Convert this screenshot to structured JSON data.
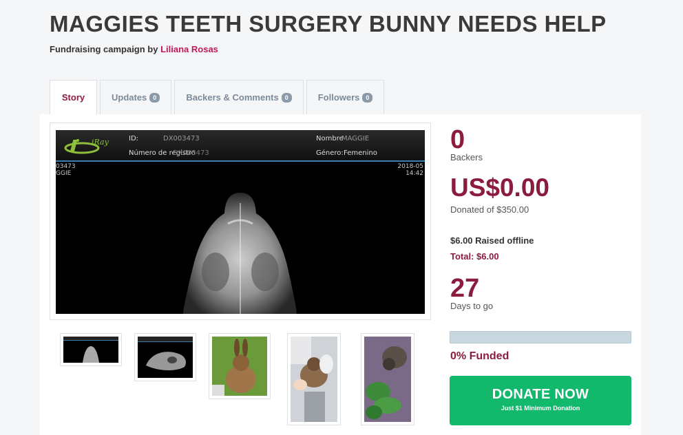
{
  "campaign": {
    "title": "MAGGIES TEETH SURGERY BUNNY NEEDS HELP",
    "subtitle_prefix": "Fundraising campaign by",
    "author": "Liliana Rosas"
  },
  "tabs": [
    {
      "label": "Story",
      "count": ""
    },
    {
      "label": "Updates",
      "count": "0"
    },
    {
      "label": "Backers & Comments",
      "count": "0"
    },
    {
      "label": "Followers",
      "count": "0"
    }
  ],
  "xray": {
    "logo_text": "iRay",
    "id_label": "ID:",
    "id_value": "DX003473",
    "nombre_label": "Nombre",
    "nombre_value": "MAGGIE",
    "registro_label": "Número de registro",
    "registro_value": "DX003473",
    "genero_label": "Género:",
    "genero_value": "Femenino",
    "left_line1": "03473",
    "left_line2": "GGIE",
    "right_line1": "2018-05",
    "right_line2": "14:42"
  },
  "stats": {
    "backers": "0",
    "backers_label": "Backers",
    "donated": "US$0.00",
    "donated_label": "Donated of $350.00",
    "offline": "$6.00 Raised offline",
    "total": "Total: $6.00",
    "days": "27",
    "days_label": "Days to go",
    "funded_percent": 0,
    "funded_label": "0% Funded"
  },
  "donate": {
    "label": "DONATE NOW",
    "sublabel": "Just $1 Minimum Donation"
  },
  "colors": {
    "accent": "#8b1c3d",
    "author_link": "#c0185a",
    "donate_green": "#12b86c",
    "progress_bg": "#c9d7e1"
  }
}
